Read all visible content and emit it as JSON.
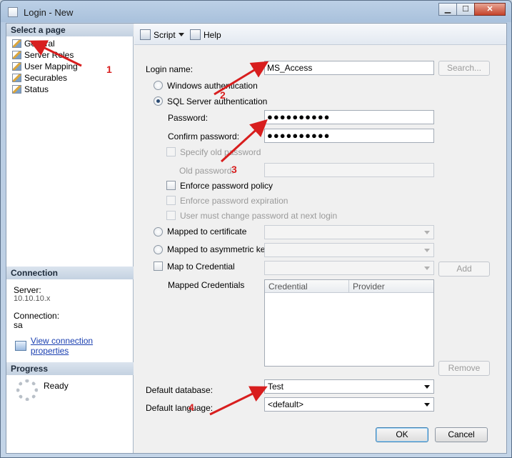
{
  "window": {
    "title": "Login - New",
    "minimize": "▁",
    "maximize": "☐",
    "close": "✕"
  },
  "left": {
    "select_page_header": "Select a page",
    "pages": [
      {
        "label": "General"
      },
      {
        "label": "Server Roles"
      },
      {
        "label": "User Mapping"
      },
      {
        "label": "Securables"
      },
      {
        "label": "Status"
      }
    ],
    "connection_header": "Connection",
    "server_label": "Server:",
    "server_value": "10.10.10.x",
    "connection_label": "Connection:",
    "connection_value": "sa",
    "view_link": "View connection properties",
    "progress_header": "Progress",
    "progress_status": "Ready"
  },
  "toolbar": {
    "script_label": "Script",
    "help_label": "Help"
  },
  "form": {
    "login_name_label": "Login name:",
    "login_name_value": "MS_Access",
    "search_button": "Search...",
    "windows_auth": "Windows authentication",
    "sql_auth": "SQL Server authentication",
    "password_label": "Password:",
    "password_value": "●●●●●●●●●●",
    "confirm_label": "Confirm password:",
    "confirm_value": "●●●●●●●●●●",
    "specify_old": "Specify old password",
    "old_password_label": "Old password:",
    "enforce_policy": "Enforce password policy",
    "enforce_expiration": "Enforce password expiration",
    "must_change": "User must change password at next login",
    "mapped_cert": "Mapped to certificate",
    "mapped_asym": "Mapped to asymmetric key",
    "map_credential": "Map to Credential",
    "add_button": "Add",
    "mapped_credentials_label": "Mapped Credentials",
    "grid_col_credential": "Credential",
    "grid_col_provider": "Provider",
    "remove_button": "Remove",
    "default_db_label": "Default database:",
    "default_db_value": "Test",
    "default_lang_label": "Default language:",
    "default_lang_value": "<default>"
  },
  "footer": {
    "ok": "OK",
    "cancel": "Cancel"
  },
  "annotations": {
    "n1": "1",
    "n2": "2",
    "n3": "3",
    "n4": "4",
    "color": "#d81e1e"
  }
}
